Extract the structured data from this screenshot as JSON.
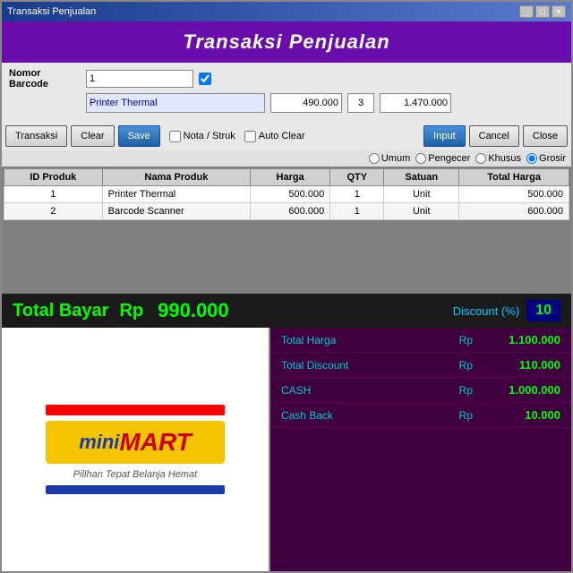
{
  "window": {
    "title": "Transaksi Penjualan",
    "title_controls": [
      "_",
      "□",
      "✕"
    ]
  },
  "header": {
    "title": "Transaksi Penjualan"
  },
  "form": {
    "nomor_barcode_label": "Nomor Barcode",
    "barcode_value": "1",
    "product_name": "Printer Thermal",
    "price_value": "490.000",
    "qty_value": "3",
    "total_value": "1.470.000"
  },
  "buttons": {
    "transaksi": "Transaksi",
    "clear": "Clear",
    "save": "Save",
    "nota_struk": "Nota / Struk",
    "auto_clear": "Auto Clear",
    "input": "Input",
    "cancel": "Cancel",
    "close": "Close"
  },
  "radio_options": [
    {
      "label": "Umum",
      "value": "umum"
    },
    {
      "label": "Pengecer",
      "value": "pengecer"
    },
    {
      "label": "Khusus",
      "value": "khusus"
    },
    {
      "label": "Grosir",
      "value": "grosir",
      "selected": true
    }
  ],
  "table": {
    "columns": [
      "ID Produk",
      "Nama Produk",
      "Harga",
      "QTY",
      "Satuan",
      "Total Harga"
    ],
    "rows": [
      {
        "id": "1",
        "name": "Printer Thermal",
        "harga": "500.000",
        "qty": "1",
        "satuan": "Unit",
        "total": "500.000"
      },
      {
        "id": "2",
        "name": "Barcode Scanner",
        "harga": "600.000",
        "qty": "1",
        "satuan": "Unit",
        "total": "600.000"
      }
    ]
  },
  "total_bar": {
    "label": "Total Bayar",
    "rp": "Rp",
    "value": "990.000",
    "discount_label": "Discount (%)",
    "discount_value": "10"
  },
  "logo": {
    "mini": "mini",
    "mart": "MART",
    "tagline": "Pillhan Tepat Belanja Hemat"
  },
  "summary": {
    "rows": [
      {
        "label": "Total Harga",
        "rp": "Rp",
        "value": "1.100.000"
      },
      {
        "label": "Total Discount",
        "rp": "Rp",
        "value": "110.000"
      },
      {
        "label": "CASH",
        "rp": "Rp",
        "value": "1.000.000"
      },
      {
        "label": "Cash Back",
        "rp": "Rp",
        "value": "10.000"
      }
    ]
  }
}
